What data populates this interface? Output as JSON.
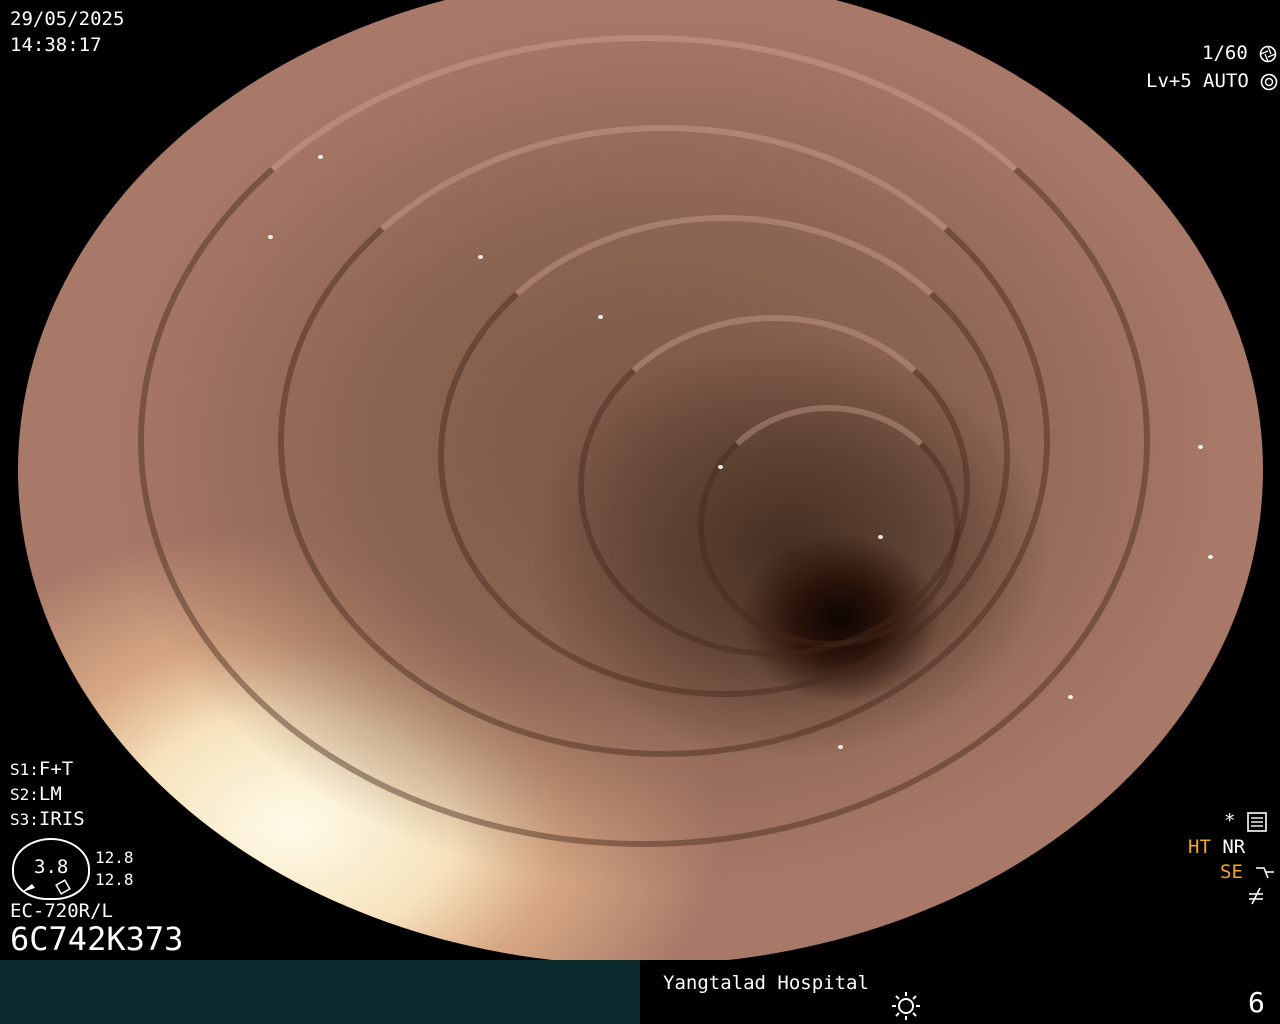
{
  "header": {
    "date": "29/05/2025",
    "time": "14:38:17",
    "shutter": "1/60",
    "level": "Lv+5",
    "mode": "AUTO"
  },
  "settings": {
    "s1_label": "S1:",
    "s1_value": "F+T",
    "s2_label": "S2:",
    "s2_value": "LM",
    "s3_label": "S3:",
    "s3_value": "IRIS"
  },
  "gauge": {
    "value": "3.8",
    "top_reading": "12.8",
    "bottom_reading": "12.8"
  },
  "scope": {
    "model": "EC-720R/L",
    "serial": "6C742K373"
  },
  "indicators": {
    "star": "*",
    "ht": "HT",
    "nr": "NR",
    "se": "SE",
    "accent": "#f5a623"
  },
  "footer": {
    "hospital": "Yangtalad Hospital",
    "number": "6",
    "left_color": "#0d2a2e"
  },
  "icons": [
    "shutter-icon",
    "auto-iris-icon",
    "settings-icon",
    "enhance-icon",
    "freeze-icon",
    "light-icon"
  ]
}
